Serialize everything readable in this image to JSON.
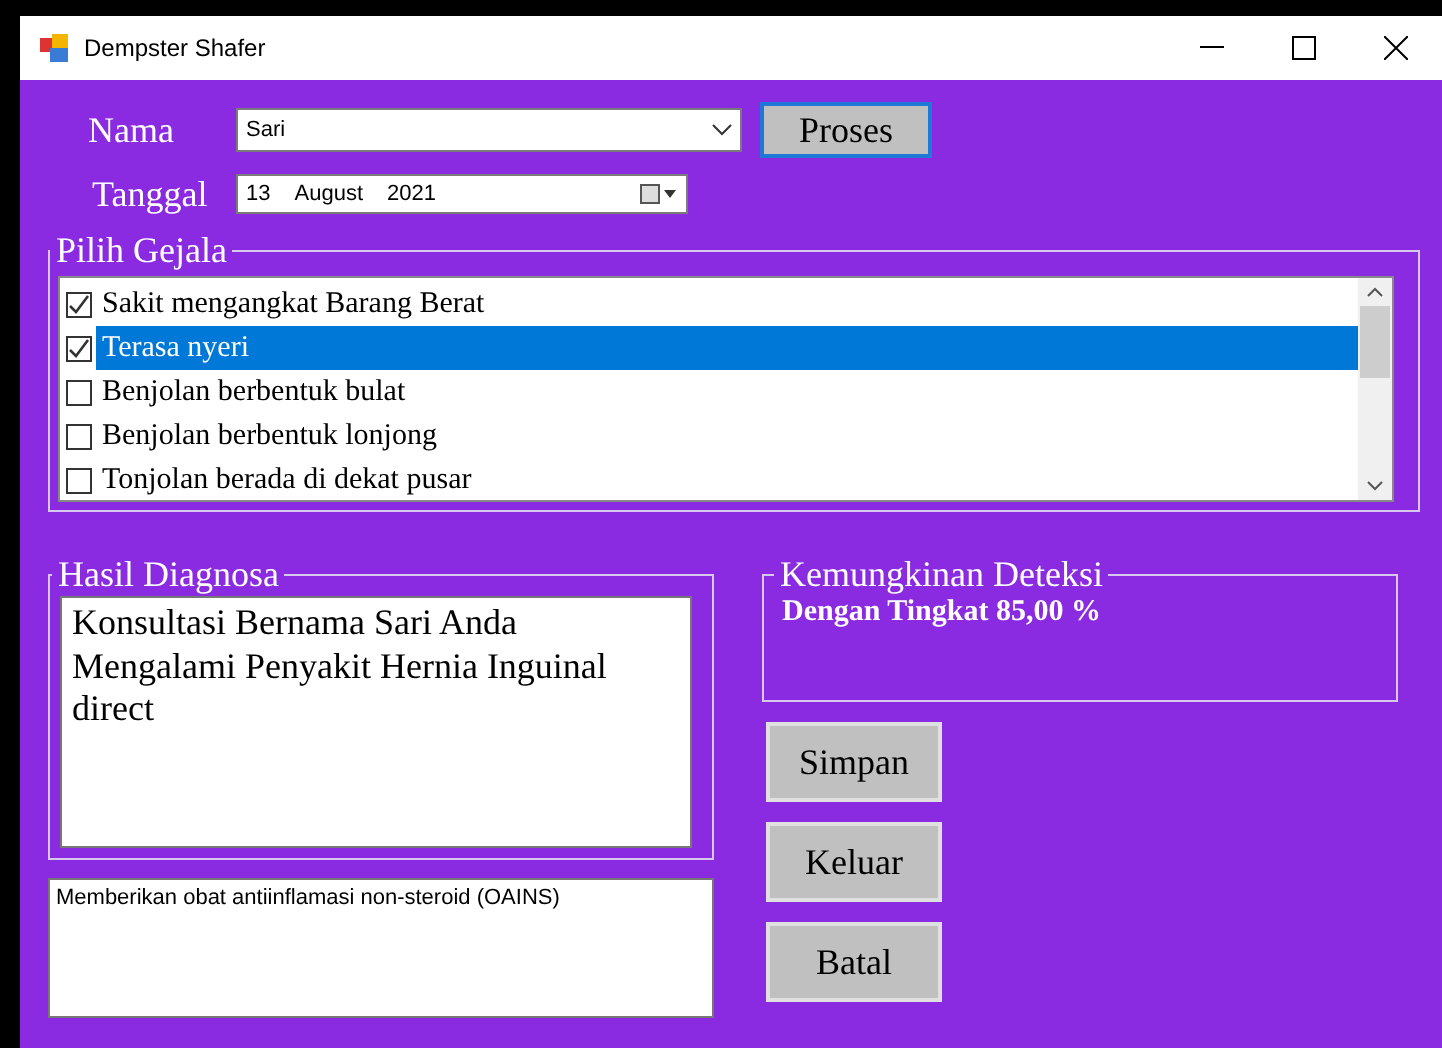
{
  "window": {
    "title": "Dempster Shafer"
  },
  "form": {
    "name_label": "Nama",
    "name_value": "Sari",
    "process_button": "Proses",
    "date_label": "Tanggal",
    "date_day": "13",
    "date_month": "August",
    "date_year": "2021"
  },
  "symptoms": {
    "title": "Pilih Gejala",
    "items": [
      {
        "label": "Sakit mengangkat Barang Berat",
        "checked": true,
        "selected": false
      },
      {
        "label": "Terasa nyeri",
        "checked": true,
        "selected": true
      },
      {
        "label": "Benjolan berbentuk bulat",
        "checked": false,
        "selected": false
      },
      {
        "label": "Benjolan berbentuk lonjong",
        "checked": false,
        "selected": false
      },
      {
        "label": "Tonjolan berada di dekat pusar",
        "checked": false,
        "selected": false
      }
    ]
  },
  "diagnosis": {
    "title": "Hasil Diagnosa",
    "result": " Konsultasi Bernama Sari Anda Mengalami Penyakit Hernia Inguinal direct",
    "treatment": "Memberikan obat antiinflamasi non-steroid (OAINS)"
  },
  "detection": {
    "title": "Kemungkinan Deteksi",
    "text": "Dengan Tingkat 85,00 %"
  },
  "buttons": [
    "Simpan",
    "Keluar",
    "Batal"
  ]
}
